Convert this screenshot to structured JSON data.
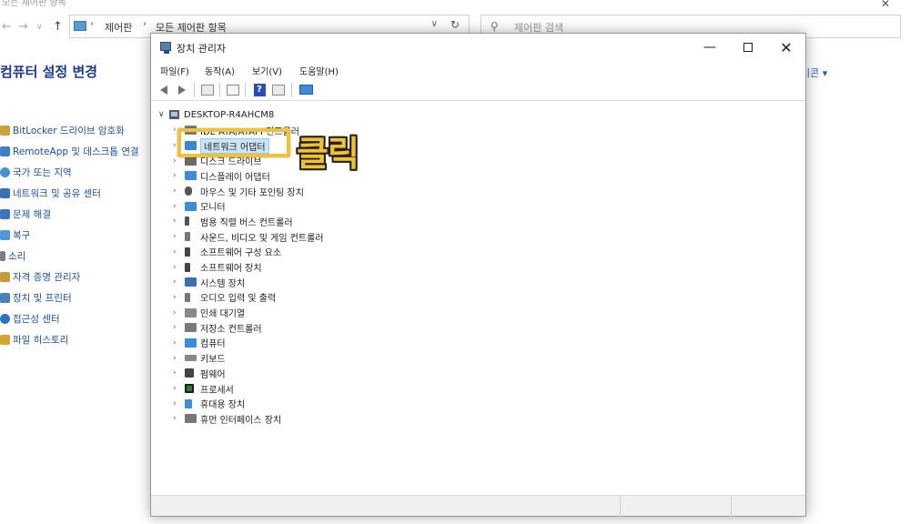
{
  "background": {
    "titlebar": {
      "title": "모든 제어판 항목",
      "close_glyph": "✕"
    },
    "nav": {
      "back": "←",
      "forward": "→",
      "dropdown": "∨",
      "up": "↑"
    },
    "address": {
      "segments": [
        "제어판",
        "모든 제어판 항목"
      ],
      "separator": "›",
      "dropdown": "∨",
      "refresh": "↻"
    },
    "search": {
      "icon_glyph": "⚲",
      "placeholder": "제어판 검색"
    },
    "heading": "컴퓨터 설정 변경",
    "view_by": "이콘 ▾",
    "items": [
      {
        "label": "BitLocker 드라이브 암호화",
        "icon": "bitlocker-icon",
        "color": "#c9a23a"
      },
      {
        "label": "RemoteApp 및 데스크톱 연결",
        "icon": "remoteapp-icon",
        "color": "#3c7fc7"
      },
      {
        "label": "국가 또는 지역",
        "icon": "region-icon",
        "color": "#4a8fd0"
      },
      {
        "label": "네트워크 및 공유 센터",
        "icon": "network-icon",
        "color": "#3a6fb0"
      },
      {
        "label": "문제 해결",
        "icon": "troubleshoot-icon",
        "color": "#3b74c4"
      },
      {
        "label": "복구",
        "icon": "recovery-icon",
        "color": "#4b9ad6"
      },
      {
        "label": "소리",
        "icon": "sound-icon",
        "color": "#7d7d7d"
      },
      {
        "label": "자격 증명 관리자",
        "icon": "credential-icon",
        "color": "#c99a3a"
      },
      {
        "label": "장치 및 프린터",
        "icon": "printer-icon",
        "color": "#4a7fb8"
      },
      {
        "label": "접근성 센터",
        "icon": "accessibility-icon",
        "color": "#2f6fc2"
      },
      {
        "label": "파일 히스토리",
        "icon": "file-history-icon",
        "color": "#d4a630"
      }
    ]
  },
  "device_manager": {
    "title": "장치 관리자",
    "controls": {
      "minimize": "—",
      "close": "✕"
    },
    "menu": [
      "파일(F)",
      "동작(A)",
      "보기(V)",
      "도움말(H)"
    ],
    "toolbar_help": "?",
    "root": {
      "expander": "∨",
      "label": "DESKTOP-R4AHCM8"
    },
    "tree": [
      {
        "label": "IDE ATA/ATAPI 컨트롤러",
        "icon": "ide-icon",
        "color": "#7a7a7a"
      },
      {
        "label": "네트워크 어댑터",
        "icon": "network-adapter-icon",
        "color": "#3a86d4",
        "selected": true
      },
      {
        "label": "디스크 드라이브",
        "icon": "disk-icon",
        "color": "#6a6a6a"
      },
      {
        "label": "디스플레이 어댑터",
        "icon": "display-adapter-icon",
        "color": "#3c8cd8"
      },
      {
        "label": "마우스 및 기타 포인팅 장치",
        "icon": "mouse-icon",
        "color": "#555555"
      },
      {
        "label": "모니터",
        "icon": "monitor-icon",
        "color": "#3c8cd8"
      },
      {
        "label": "범용 직렬 버스 컨트롤러",
        "icon": "usb-icon",
        "color": "#555555"
      },
      {
        "label": "사운드, 비디오 및 게임 컨트롤러",
        "icon": "sound-device-icon",
        "color": "#777777"
      },
      {
        "label": "소프트웨어 구성 요소",
        "icon": "software-component-icon",
        "color": "#444444"
      },
      {
        "label": "소프트웨어 장치",
        "icon": "software-device-icon",
        "color": "#444444"
      },
      {
        "label": "시스템 장치",
        "icon": "system-device-icon",
        "color": "#3a6fb0"
      },
      {
        "label": "오디오 입력 및 출력",
        "icon": "audio-io-icon",
        "color": "#777777"
      },
      {
        "label": "인쇄 대기열",
        "icon": "print-queue-icon",
        "color": "#888888"
      },
      {
        "label": "저장소 컨트롤러",
        "icon": "storage-controller-icon",
        "color": "#7a7a7a"
      },
      {
        "label": "컴퓨터",
        "icon": "computer-icon",
        "color": "#3c8cd8"
      },
      {
        "label": "키보드",
        "icon": "keyboard-icon",
        "color": "#888888"
      },
      {
        "label": "펌웨어",
        "icon": "firmware-icon",
        "color": "#444444"
      },
      {
        "label": "프로세서",
        "icon": "processor-icon",
        "color": "#2e7d32"
      },
      {
        "label": "휴대용 장치",
        "icon": "portable-device-icon",
        "color": "#3c8cd8"
      },
      {
        "label": "휴먼 인터페이스 장치",
        "icon": "hid-icon",
        "color": "#777777"
      }
    ],
    "tree_expander": "›"
  },
  "annotation": {
    "text": "클릭",
    "color": "#f2c233"
  }
}
